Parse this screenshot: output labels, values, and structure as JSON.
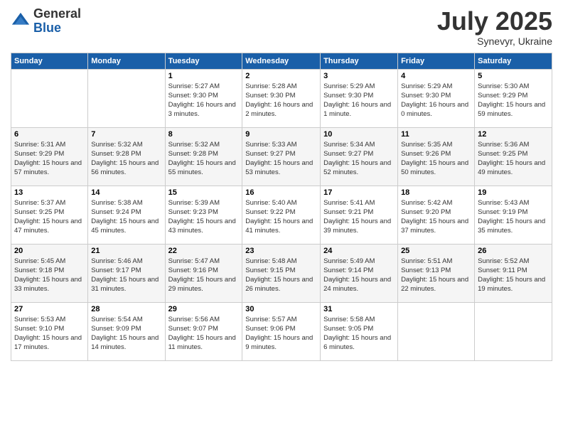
{
  "logo": {
    "general": "General",
    "blue": "Blue"
  },
  "title": {
    "month": "July 2025",
    "location": "Synevyr, Ukraine"
  },
  "headers": [
    "Sunday",
    "Monday",
    "Tuesday",
    "Wednesday",
    "Thursday",
    "Friday",
    "Saturday"
  ],
  "weeks": [
    [
      {
        "day": "",
        "sunrise": "",
        "sunset": "",
        "daylight": ""
      },
      {
        "day": "",
        "sunrise": "",
        "sunset": "",
        "daylight": ""
      },
      {
        "day": "1",
        "sunrise": "Sunrise: 5:27 AM",
        "sunset": "Sunset: 9:30 PM",
        "daylight": "Daylight: 16 hours and 3 minutes."
      },
      {
        "day": "2",
        "sunrise": "Sunrise: 5:28 AM",
        "sunset": "Sunset: 9:30 PM",
        "daylight": "Daylight: 16 hours and 2 minutes."
      },
      {
        "day": "3",
        "sunrise": "Sunrise: 5:29 AM",
        "sunset": "Sunset: 9:30 PM",
        "daylight": "Daylight: 16 hours and 1 minute."
      },
      {
        "day": "4",
        "sunrise": "Sunrise: 5:29 AM",
        "sunset": "Sunset: 9:30 PM",
        "daylight": "Daylight: 16 hours and 0 minutes."
      },
      {
        "day": "5",
        "sunrise": "Sunrise: 5:30 AM",
        "sunset": "Sunset: 9:29 PM",
        "daylight": "Daylight: 15 hours and 59 minutes."
      }
    ],
    [
      {
        "day": "6",
        "sunrise": "Sunrise: 5:31 AM",
        "sunset": "Sunset: 9:29 PM",
        "daylight": "Daylight: 15 hours and 57 minutes."
      },
      {
        "day": "7",
        "sunrise": "Sunrise: 5:32 AM",
        "sunset": "Sunset: 9:28 PM",
        "daylight": "Daylight: 15 hours and 56 minutes."
      },
      {
        "day": "8",
        "sunrise": "Sunrise: 5:32 AM",
        "sunset": "Sunset: 9:28 PM",
        "daylight": "Daylight: 15 hours and 55 minutes."
      },
      {
        "day": "9",
        "sunrise": "Sunrise: 5:33 AM",
        "sunset": "Sunset: 9:27 PM",
        "daylight": "Daylight: 15 hours and 53 minutes."
      },
      {
        "day": "10",
        "sunrise": "Sunrise: 5:34 AM",
        "sunset": "Sunset: 9:27 PM",
        "daylight": "Daylight: 15 hours and 52 minutes."
      },
      {
        "day": "11",
        "sunrise": "Sunrise: 5:35 AM",
        "sunset": "Sunset: 9:26 PM",
        "daylight": "Daylight: 15 hours and 50 minutes."
      },
      {
        "day": "12",
        "sunrise": "Sunrise: 5:36 AM",
        "sunset": "Sunset: 9:25 PM",
        "daylight": "Daylight: 15 hours and 49 minutes."
      }
    ],
    [
      {
        "day": "13",
        "sunrise": "Sunrise: 5:37 AM",
        "sunset": "Sunset: 9:25 PM",
        "daylight": "Daylight: 15 hours and 47 minutes."
      },
      {
        "day": "14",
        "sunrise": "Sunrise: 5:38 AM",
        "sunset": "Sunset: 9:24 PM",
        "daylight": "Daylight: 15 hours and 45 minutes."
      },
      {
        "day": "15",
        "sunrise": "Sunrise: 5:39 AM",
        "sunset": "Sunset: 9:23 PM",
        "daylight": "Daylight: 15 hours and 43 minutes."
      },
      {
        "day": "16",
        "sunrise": "Sunrise: 5:40 AM",
        "sunset": "Sunset: 9:22 PM",
        "daylight": "Daylight: 15 hours and 41 minutes."
      },
      {
        "day": "17",
        "sunrise": "Sunrise: 5:41 AM",
        "sunset": "Sunset: 9:21 PM",
        "daylight": "Daylight: 15 hours and 39 minutes."
      },
      {
        "day": "18",
        "sunrise": "Sunrise: 5:42 AM",
        "sunset": "Sunset: 9:20 PM",
        "daylight": "Daylight: 15 hours and 37 minutes."
      },
      {
        "day": "19",
        "sunrise": "Sunrise: 5:43 AM",
        "sunset": "Sunset: 9:19 PM",
        "daylight": "Daylight: 15 hours and 35 minutes."
      }
    ],
    [
      {
        "day": "20",
        "sunrise": "Sunrise: 5:45 AM",
        "sunset": "Sunset: 9:18 PM",
        "daylight": "Daylight: 15 hours and 33 minutes."
      },
      {
        "day": "21",
        "sunrise": "Sunrise: 5:46 AM",
        "sunset": "Sunset: 9:17 PM",
        "daylight": "Daylight: 15 hours and 31 minutes."
      },
      {
        "day": "22",
        "sunrise": "Sunrise: 5:47 AM",
        "sunset": "Sunset: 9:16 PM",
        "daylight": "Daylight: 15 hours and 29 minutes."
      },
      {
        "day": "23",
        "sunrise": "Sunrise: 5:48 AM",
        "sunset": "Sunset: 9:15 PM",
        "daylight": "Daylight: 15 hours and 26 minutes."
      },
      {
        "day": "24",
        "sunrise": "Sunrise: 5:49 AM",
        "sunset": "Sunset: 9:14 PM",
        "daylight": "Daylight: 15 hours and 24 minutes."
      },
      {
        "day": "25",
        "sunrise": "Sunrise: 5:51 AM",
        "sunset": "Sunset: 9:13 PM",
        "daylight": "Daylight: 15 hours and 22 minutes."
      },
      {
        "day": "26",
        "sunrise": "Sunrise: 5:52 AM",
        "sunset": "Sunset: 9:11 PM",
        "daylight": "Daylight: 15 hours and 19 minutes."
      }
    ],
    [
      {
        "day": "27",
        "sunrise": "Sunrise: 5:53 AM",
        "sunset": "Sunset: 9:10 PM",
        "daylight": "Daylight: 15 hours and 17 minutes."
      },
      {
        "day": "28",
        "sunrise": "Sunrise: 5:54 AM",
        "sunset": "Sunset: 9:09 PM",
        "daylight": "Daylight: 15 hours and 14 minutes."
      },
      {
        "day": "29",
        "sunrise": "Sunrise: 5:56 AM",
        "sunset": "Sunset: 9:07 PM",
        "daylight": "Daylight: 15 hours and 11 minutes."
      },
      {
        "day": "30",
        "sunrise": "Sunrise: 5:57 AM",
        "sunset": "Sunset: 9:06 PM",
        "daylight": "Daylight: 15 hours and 9 minutes."
      },
      {
        "day": "31",
        "sunrise": "Sunrise: 5:58 AM",
        "sunset": "Sunset: 9:05 PM",
        "daylight": "Daylight: 15 hours and 6 minutes."
      },
      {
        "day": "",
        "sunrise": "",
        "sunset": "",
        "daylight": ""
      },
      {
        "day": "",
        "sunrise": "",
        "sunset": "",
        "daylight": ""
      }
    ]
  ]
}
